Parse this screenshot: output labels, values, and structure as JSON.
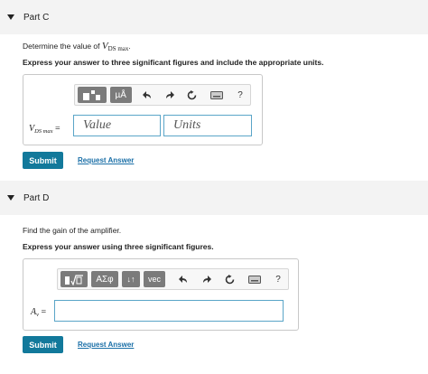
{
  "part_c": {
    "title": "Part C",
    "prompt_prefix": "Determine the value of ",
    "var_main": "V",
    "var_sub": "DS max",
    "prompt_suffix": ".",
    "instruction": "Express your answer to three significant figures and include the appropriate units.",
    "label_main": "V",
    "label_sub": "DS max",
    "label_eq": " =",
    "value_placeholder": "Value",
    "units_placeholder": "Units",
    "toolbar": {
      "templates_icon": "templates-icon",
      "units_label": "µÅ",
      "undo_icon": "undo-icon",
      "redo_icon": "redo-icon",
      "reset_icon": "reset-icon",
      "keyboard_icon": "keyboard-icon",
      "help_label": "?"
    },
    "submit_label": "Submit",
    "request_label": "Request Answer"
  },
  "part_d": {
    "title": "Part D",
    "prompt": "Find the gain of the amplifier.",
    "instruction": "Express your answer using three significant figures.",
    "label_main": "A",
    "label_sub": "v",
    "label_eq": " =",
    "toolbar": {
      "templates_icon": "templates-icon",
      "greek_label": "ΑΣφ",
      "arrows_label": "↓↑",
      "vec_label": "vec",
      "undo_icon": "undo-icon",
      "redo_icon": "redo-icon",
      "reset_icon": "reset-icon",
      "keyboard_icon": "keyboard-icon",
      "help_label": "?"
    },
    "submit_label": "Submit",
    "request_label": "Request Answer"
  },
  "colors": {
    "header_bg": "#f3f3f3",
    "submit_bg": "#12799b",
    "link": "#1a6fa7",
    "input_border": "#5aa5c8",
    "toolbar_dark": "#7b7b7b"
  }
}
